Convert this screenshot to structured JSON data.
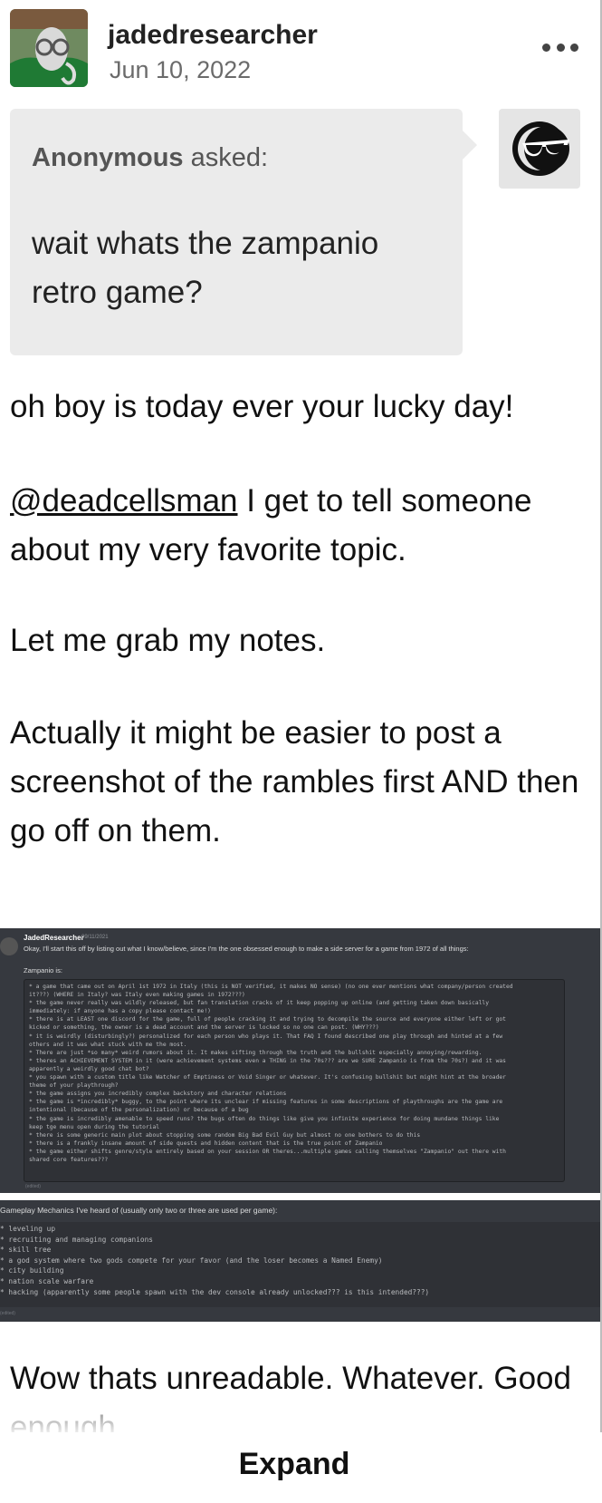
{
  "post": {
    "username": "jadedresearcher",
    "date": "Jun 10, 2022"
  },
  "ask": {
    "asker": "Anonymous",
    "asked_suffix": "asked:",
    "question": "wait whats the zampanio retro game?"
  },
  "body": {
    "p1": "oh boy is today ever your lucky day!",
    "mention": "@deadcellsman",
    "p2_rest": " I get to tell someone about my very favorite topic.",
    "p3": "Let me grab my notes.",
    "p4": "Actually it might be easier to post a screenshot of the rambles first AND then go off on them.",
    "p5": "Wow thats unreadable. Whatever. Good enough."
  },
  "screenshot1": {
    "name": "JadedResearcher",
    "date": "09/11/2021",
    "intro": "Okay, I'll start this off by listing out what I know/believe, since I'm the one obsessed enough to make a side server for a game from 1972 of all things:",
    "label": "Zampanio is:",
    "lines": [
      "* a game that came out on April 1st 1972 in Italy (this is NOT verified, it makes NO sense) (no one ever mentions what company/person created",
      "it???) (WHERE in Italy? was Italy even making games in 1972???)",
      "* the game never really was wildly released, but fan translation cracks of it keep popping up online (and getting taken down basically",
      "immediately: if anyone has a copy please contact me!)",
      "* there is at LEAST one discord for the game, full of people cracking it and trying to decompile the source and everyone either left or got",
      "kicked or something, the owner is a dead account and the server is locked so no one can post. (WHY???)",
      "* it is weirdly (disturbingly?) personalized for each person who plays it.  That FAQ I found described one play through and hinted at a few",
      "others and it was what stuck with me the most.",
      "* There are just *so many* weird rumors about it. It makes sifting through the truth and the bullshit especially annoying/rewarding.",
      "* theres an ACHIEVEMENT SYSTEM in it (were achievement systems even a THING in the 70s??? are we SURE Zampanio is from the 70s?) and it was",
      "apparently a weirdly good chat bot?",
      "* you spawn with a custom title like Watcher of Emptiness or Void Singer or whatever. It's confusing bullshit but might hint at the broader",
      "theme of your playthrough?",
      "* the game assigns you incredibly complex backstory and character relations",
      "* the game is *incredibly* buggy, to the point where its unclear if missing features in some descriptions of playthroughs are the game are",
      "intentional (because of the personalization) or because of a bug",
      "* the game is incredibly amenable to speed runs? the bugs often do things like give you infinite experience for doing mundane things like",
      "keep tge menu open during the tutorial",
      "* there is some generic main plot about stopping some random Big Bad Evil Guy but almost no one bothers to do this",
      "* there is a frankly insane amount of side quests and hidden content that is the true point of Zampanio",
      "* the game either shifts genre/style entirely based on your session OR theres...multiple games calling themselves \"Zampanio\" out there with",
      "shared core features???"
    ],
    "edited": "(edited)"
  },
  "screenshot2": {
    "label": "Gameplay Mechanics I've heard of (usually only two or three are used per game):",
    "lines": [
      "* leveling up",
      "* recruiting and managing companions",
      "* skill tree",
      "* a god system where two gods compete for your favor (and the loser becomes a Named Enemy)",
      "* city building",
      "* nation scale warfare",
      "* hacking (apparently some people spawn with the dev console already unlocked??? is this intended???)"
    ],
    "edited": "(edited)"
  },
  "expand_label": "Expand"
}
